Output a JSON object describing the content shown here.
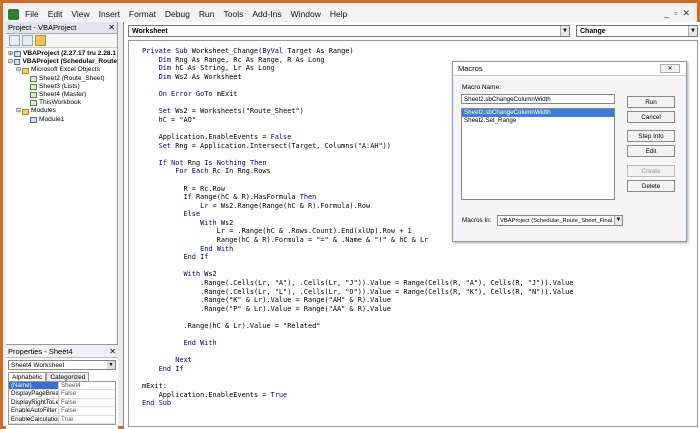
{
  "menubar": {
    "items": [
      "File",
      "Edit",
      "View",
      "Insert",
      "Format",
      "Debug",
      "Run",
      "Tools",
      "Add-Ins",
      "Window",
      "Help"
    ],
    "controls": [
      "_",
      "▫",
      "✕"
    ]
  },
  "project": {
    "title": "Project - VBAProject",
    "close": "✕",
    "tree": [
      {
        "toggle": "⊞",
        "icon": "mod",
        "label": "VBAProject (2.27.17 tru 2.28.1",
        "bold": true,
        "indent": 0
      },
      {
        "toggle": "⊟",
        "icon": "mod",
        "label": "VBAProject (Schedular_Route",
        "bold": true,
        "indent": 0
      },
      {
        "toggle": "⊟",
        "icon": "folder",
        "label": "Microsoft Excel Objects",
        "bold": false,
        "indent": 1
      },
      {
        "toggle": "",
        "icon": "sheet",
        "label": "Sheet2 (Route_Sheet)",
        "bold": false,
        "indent": 2
      },
      {
        "toggle": "",
        "icon": "sheet",
        "label": "Sheet3 (Lists)",
        "bold": false,
        "indent": 2
      },
      {
        "toggle": "",
        "icon": "sheet",
        "label": "Sheet4 (Master)",
        "bold": false,
        "indent": 2
      },
      {
        "toggle": "",
        "icon": "sheet",
        "label": "ThisWorkbook",
        "bold": false,
        "indent": 2
      },
      {
        "toggle": "⊟",
        "icon": "folder",
        "label": "Modules",
        "bold": false,
        "indent": 1
      },
      {
        "toggle": "",
        "icon": "mod",
        "label": "Module1",
        "bold": false,
        "indent": 2
      }
    ]
  },
  "properties": {
    "title": "Properties - Sheet4",
    "close": "✕",
    "object": "Sheet4 Worksheet",
    "tabs": [
      "Alphabetic",
      "Categorized"
    ],
    "rows": [
      {
        "name": "(Name)",
        "value": "Sheet4"
      },
      {
        "name": "DisplayPageBreaks",
        "value": "False"
      },
      {
        "name": "DisplayRightToLeft",
        "value": "False"
      },
      {
        "name": "EnableAutoFilter",
        "value": "False"
      },
      {
        "name": "EnableCalculation",
        "value": "True"
      }
    ]
  },
  "code_window": {
    "object_select": "Worksheet",
    "procedure_select": "Change",
    "lines": [
      "Private Sub Worksheet_Change(ByVal Target As Range)",
      "    Dim Rng As Range, Rc As Range, R As Long",
      "    Dim hC As String, Lr As Long",
      "    Dim Ws2 As Worksheet",
      "",
      "    On Error GoTo mExit",
      "",
      "    Set Ws2 = Worksheets(\"Route_Sheet\")",
      "    hC = \"AO\"",
      "",
      "    Application.EnableEvents = False",
      "    Set Rng = Application.Intersect(Target, Columns(\"A:AH\"))",
      "",
      "    If Not Rng Is Nothing Then",
      "        For Each Rc In Rng.Rows",
      "",
      "          R = Rc.Row",
      "          If Range(hC & R).HasFormula Then",
      "              Lr = Ws2.Range(Range(hC & R).Formula).Row",
      "          Else",
      "              With Ws2",
      "                  Lr = .Range(hC & .Rows.Count).End(xlUp).Row + 1",
      "                  Range(hC & R).Formula = \"=\" & .Name & \"!\" & hC & Lr",
      "              End With",
      "          End If",
      "",
      "          With Ws2",
      "              .Range(.Cells(Lr, \"A\"), .Cells(Lr, \"J\")).Value = Range(Cells(R, \"A\"), Cells(R, \"J\")).Value",
      "              .Range(.Cells(Lr, \"L\"), .Cells(Lr, \"O\")).Value = Range(Cells(R, \"K\"), Cells(R, \"N\")).Value",
      "              .Range(\"K\" & Lr).Value = Range(\"AH\" & R).Value",
      "              .Range(\"P\" & Lr).Value = Range(\"AA\" & R).Value",
      "",
      "          .Range(hC & Lr).Value = \"Related\"",
      "",
      "          End With",
      "",
      "        Next",
      "    End If",
      "",
      "mExit:",
      "    Application.EnableEvents = True",
      "End Sub"
    ]
  },
  "macros_dialog": {
    "title": "Macros",
    "close": "✕",
    "name_label": "Macro Name:",
    "name_value": "Sheet2.sbChangeColumnWidth",
    "list": [
      "Sheet2.sbChangeColumnWidth",
      "Sheet2.Set_Range"
    ],
    "selected_index": 0,
    "buttons": [
      {
        "label": "Run",
        "enabled": true
      },
      {
        "label": "Cancel",
        "enabled": true
      },
      {
        "label": "Step Into",
        "enabled": true
      },
      {
        "label": "Edit",
        "enabled": true
      },
      {
        "label": "Create",
        "enabled": false
      },
      {
        "label": "Delete",
        "enabled": true
      }
    ],
    "macros_in_label": "Macros In:",
    "macros_in_value": "VBAProject (Schedular_Route_Sheet_Final.x"
  }
}
